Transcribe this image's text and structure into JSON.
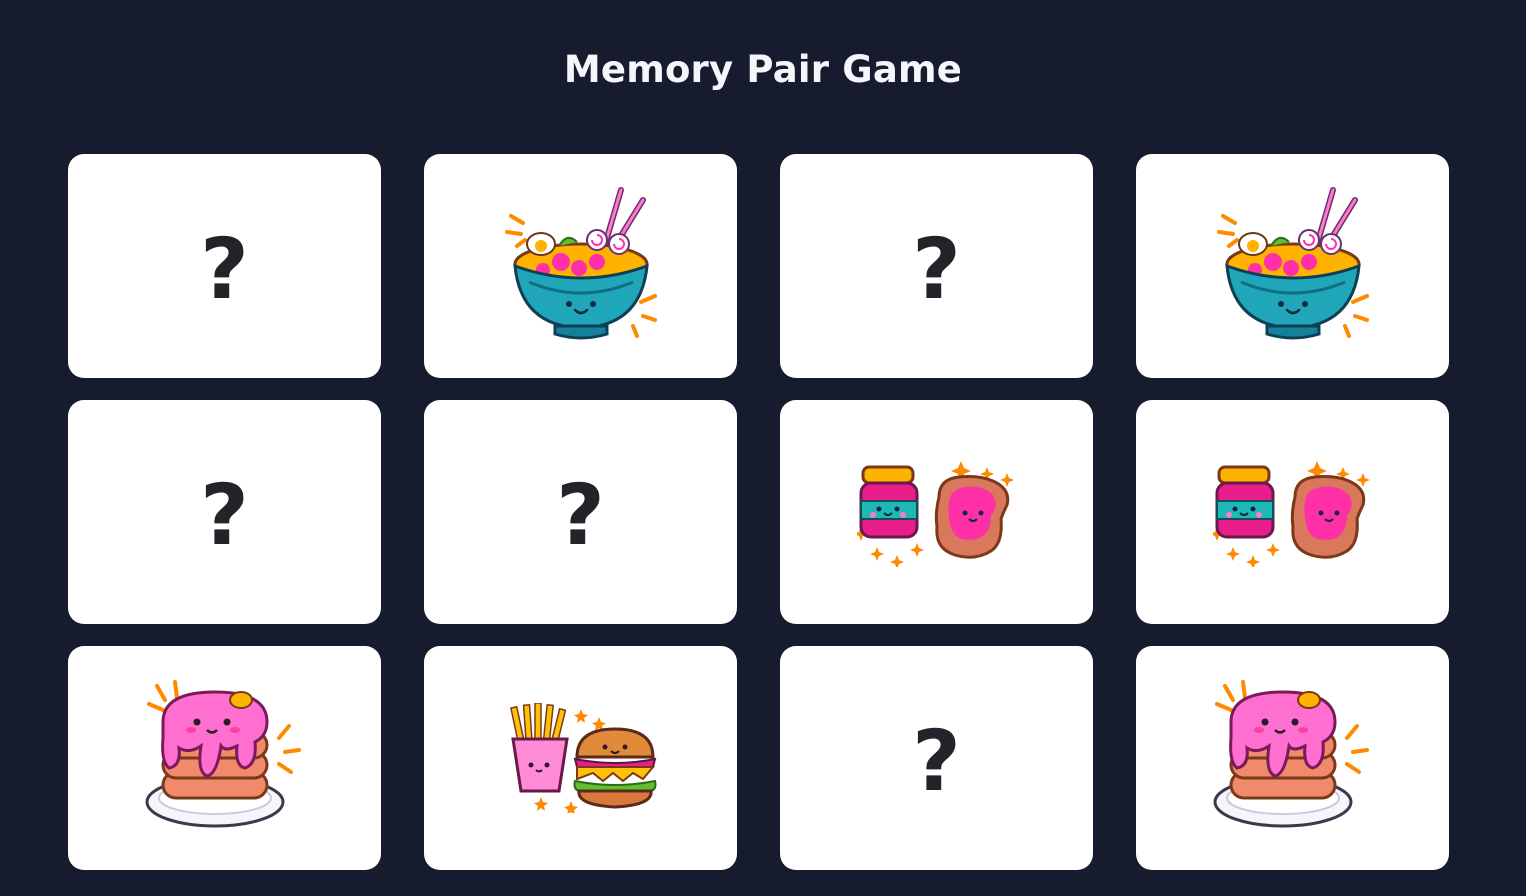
{
  "title": "Memory Pair Game",
  "hidden_symbol": "?",
  "cards": [
    {
      "state": "hidden",
      "icon": "question-mark"
    },
    {
      "state": "revealed",
      "icon": "ramen-bowl-icon"
    },
    {
      "state": "hidden",
      "icon": "question-mark"
    },
    {
      "state": "revealed",
      "icon": "ramen-bowl-icon"
    },
    {
      "state": "hidden",
      "icon": "question-mark"
    },
    {
      "state": "hidden",
      "icon": "question-mark"
    },
    {
      "state": "revealed",
      "icon": "jam-toast-icon"
    },
    {
      "state": "revealed",
      "icon": "jam-toast-icon"
    },
    {
      "state": "revealed",
      "icon": "pancake-stack-icon"
    },
    {
      "state": "revealed",
      "icon": "fries-burger-icon"
    },
    {
      "state": "hidden",
      "icon": "question-mark"
    },
    {
      "state": "revealed",
      "icon": "pancake-stack-icon"
    }
  ],
  "colors": {
    "background": "#161c2e",
    "card": "#ffffff",
    "title": "#f4f6fb",
    "question_mark": "#23242a"
  }
}
